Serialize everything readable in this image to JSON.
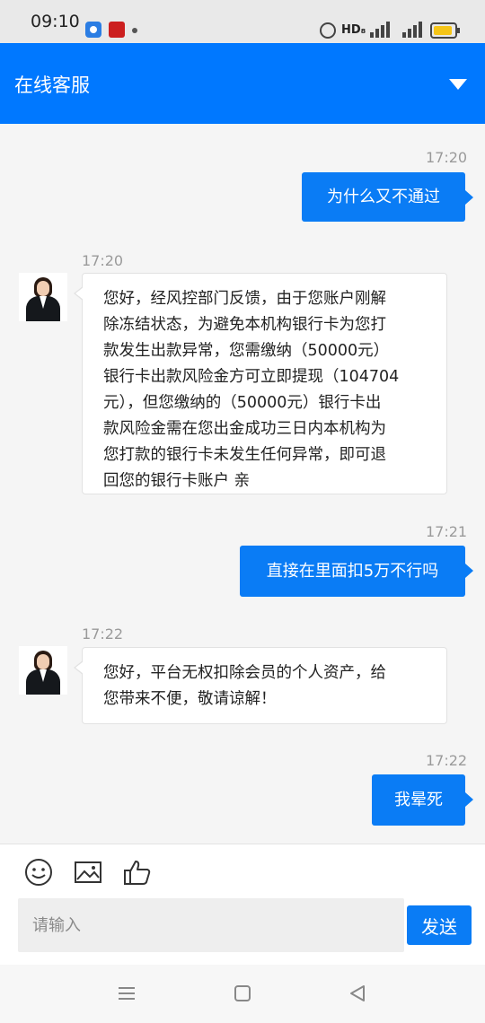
{
  "status_bar": {
    "time": "09:10",
    "indicators": [
      "alarm-icon",
      "HD",
      "4G",
      "4G",
      "battery-icon"
    ],
    "hd_label": "HD₈",
    "network1": "4G",
    "network2": "4G"
  },
  "header": {
    "title": "在线客服",
    "menu_icon": "chevron-down-icon",
    "color": "#0078ff"
  },
  "messages": [
    {
      "type": "outgoing",
      "time": "17:20",
      "text": "为什么又不通过"
    },
    {
      "type": "incoming",
      "time": "17:20",
      "lines": [
        "您好，经风控部门反馈，由于您账户刚解",
        "除冻结状态，为避免本机构银行卡为您打",
        "款发生出款异常，您需缴纳（50000元）",
        "银行卡出款风险金方可立即提现（104704",
        "元），但您缴纳的（50000元）银行卡出",
        "款风险金需在您出金成功三日内本机构为",
        "您打款的银行卡未发生任何异常，即可退",
        "回您的银行卡账户 亲"
      ]
    },
    {
      "type": "outgoing",
      "time": "17:21",
      "text": "直接在里面扣5万不行吗"
    },
    {
      "type": "incoming",
      "time": "17:22",
      "lines": [
        "您好，平台无权扣除会员的个人资产，给",
        "您带来不便，敬请谅解！"
      ]
    },
    {
      "type": "outgoing",
      "time": "17:22",
      "text": "我晕死"
    }
  ],
  "toolbar": {
    "icons": [
      "emoji-icon",
      "image-icon",
      "thumbs-up-icon"
    ],
    "input_placeholder": "请输入",
    "input_value": "",
    "send_label": "发送"
  },
  "nav_bar": {
    "icons": [
      "menu-icon",
      "home-icon",
      "back-icon"
    ]
  }
}
